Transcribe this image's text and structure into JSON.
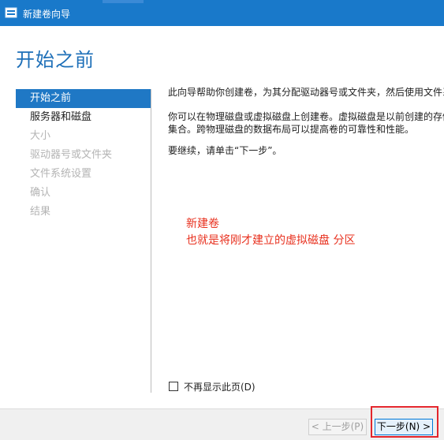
{
  "window": {
    "title": "新建卷向导"
  },
  "page": {
    "heading": "开始之前"
  },
  "nav": [
    {
      "label": "开始之前",
      "state": "active"
    },
    {
      "label": "服务器和磁盘",
      "state": "enabled"
    },
    {
      "label": "大小",
      "state": "disabled"
    },
    {
      "label": "驱动器号或文件夹",
      "state": "disabled"
    },
    {
      "label": "文件系统设置",
      "state": "disabled"
    },
    {
      "label": "确认",
      "state": "disabled"
    },
    {
      "label": "结果",
      "state": "disabled"
    }
  ],
  "content": {
    "p1": "此向导帮助你创建卷，为其分配驱动器号或文件夹，然后使用文件系统格式化卷。",
    "p2_line1": "你可以在物理磁盘或虚拟磁盘上创建卷。虚拟磁盘是以前创建的存储空间中的物理磁盘",
    "p2_line2": "集合。跨物理磁盘的数据布局可以提高卷的可靠性和性能。",
    "p3": "要继续，请单击“下一步”。"
  },
  "annotation": {
    "line1": "新建卷",
    "line2": "也就是将刚才建立的虚拟磁盘 分区",
    "color": "#e8301e"
  },
  "options": {
    "dont_show_label": "不再显示此页(D)",
    "dont_show_checked": false
  },
  "footer": {
    "prev_label": "< 上一步(P)",
    "next_label": "下一步(N) >"
  },
  "colors": {
    "titlebar": "#1979ca",
    "accent": "#1f78c5",
    "heading": "#1d6fb8",
    "highlight": "#e3252b"
  }
}
